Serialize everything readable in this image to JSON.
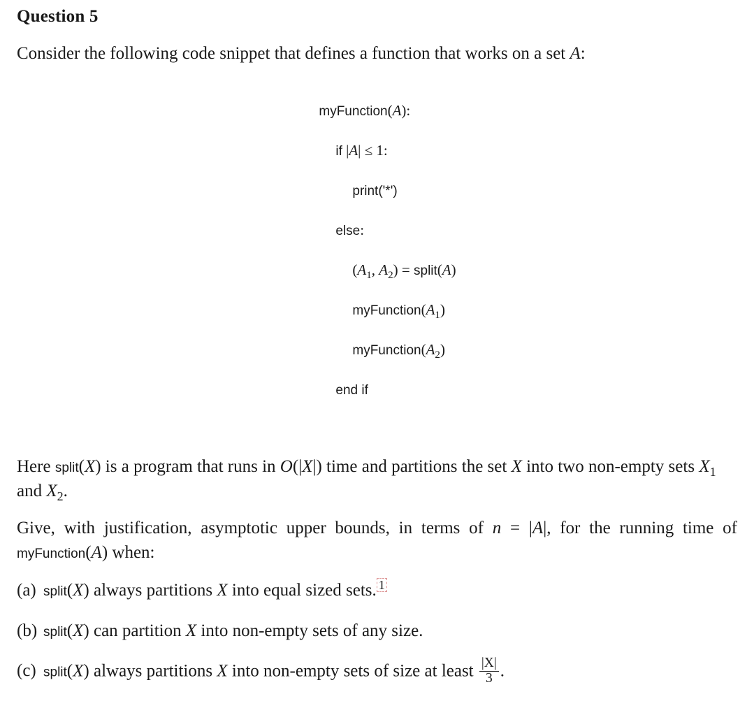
{
  "title": "Question 5",
  "intro_prefix": "Consider the following code snippet that defines a function that works on a set ",
  "intro_var": "A",
  "intro_suffix": ":",
  "code": {
    "l1a": "myFunction",
    "l1b": "(",
    "l1c": "A",
    "l1d": "):",
    "l2a": "if",
    "l2b": " |",
    "l2c": "A",
    "l2d": "| ≤ 1:",
    "l3a": "print",
    "l3b": "('*')",
    "l4a": "else",
    "l4b": ":",
    "l5a": "(",
    "l5b": "A",
    "l5sub1": "1",
    "l5c": ", ",
    "l5d": "A",
    "l5sub2": "2",
    "l5e": ") = ",
    "l5f": "split",
    "l5g": "(",
    "l5h": "A",
    "l5i": ")",
    "l6a": "myFunction",
    "l6b": "(",
    "l6c": "A",
    "l6sub": "1",
    "l6d": ")",
    "l7a": "myFunction",
    "l7b": "(",
    "l7c": "A",
    "l7sub": "2",
    "l7d": ")",
    "l8a": "end if"
  },
  "p2": {
    "a": "Here ",
    "b": "split",
    "c": "(",
    "d": "X",
    "e": ") is a program that runs in ",
    "f": "O",
    "g": "(|",
    "h": "X",
    "i": "|) time and partitions the set ",
    "j": "X",
    "k": " into two non-empty sets ",
    "l": "X",
    "lsub": "1",
    "m": " and ",
    "n": "X",
    "nsub": "2",
    "o": "."
  },
  "p3": {
    "a": "Give, with justification, asymptotic upper bounds, in terms of ",
    "b": "n",
    "c": " = |",
    "d": "A",
    "e": "|, for the run­ning time of ",
    "f": "myFunction",
    "g": "(",
    "h": "A",
    "i": ") when:"
  },
  "parts": {
    "a": {
      "label": "(a)",
      "t1": "split",
      "t2": "(",
      "t3": "X",
      "t4": ") always partitions ",
      "t5": "X",
      "t6": " into equal sized sets.",
      "fn": "1"
    },
    "b": {
      "label": "(b)",
      "t1": "split",
      "t2": "(",
      "t3": "X",
      "t4": ") can partition ",
      "t5": "X",
      "t6": " into non-empty sets of any size."
    },
    "c": {
      "label": "(c)",
      "t1": "split",
      "t2": "(",
      "t3": "X",
      "t4": ") always partitions ",
      "t5": "X",
      "t6": " into non-empty sets of size at least ",
      "num": "|X|",
      "den": "3",
      "t7": "."
    }
  }
}
